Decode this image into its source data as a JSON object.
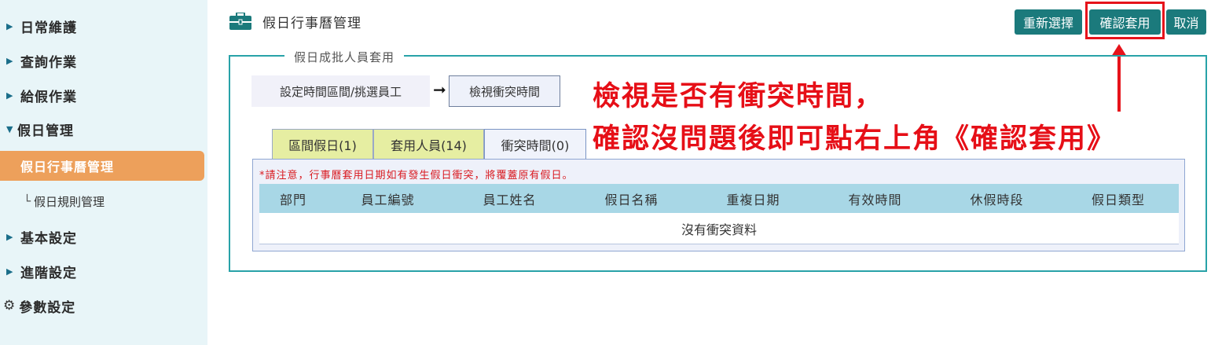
{
  "sidebar": {
    "items": [
      {
        "label": "日常維護"
      },
      {
        "label": "查詢作業"
      },
      {
        "label": "給假作業"
      },
      {
        "label": "假日管理"
      },
      {
        "label": "假日行事曆管理"
      },
      {
        "label": "假日規則管理",
        "prefix": "└"
      },
      {
        "label": "基本設定"
      },
      {
        "label": "進階設定"
      },
      {
        "label": "參數設定"
      }
    ]
  },
  "header": {
    "title": "假日行事曆管理",
    "buttons": {
      "reselect": "重新選擇",
      "confirm_apply": "確認套用",
      "cancel": "取消"
    }
  },
  "fieldset": {
    "legend": "假日成批人員套用",
    "steps": [
      "設定時間區間/挑選員工",
      "檢視衝突時間"
    ]
  },
  "annotation": {
    "line1": "檢視是否有衝突時間，",
    "line2": "確認沒問題後即可點右上角《確認套用》"
  },
  "tabs": [
    {
      "label": "區間假日(1)"
    },
    {
      "label": "套用人員(14)"
    },
    {
      "label": "衝突時間(0)"
    }
  ],
  "notice": "*請注意，行事曆套用日期如有發生假日衝突，將覆蓋原有假日。",
  "table": {
    "columns": [
      "部門",
      "員工編號",
      "員工姓名",
      "假日名稱",
      "重複日期",
      "有效時間",
      "休假時段",
      "假日類型"
    ],
    "empty_message": "沒有衝突資料"
  },
  "colors": {
    "accent": "#1b7a7c",
    "highlight": "#e6131b",
    "active_nav": "#eda05b",
    "sidebar_bg": "#e8f5f8",
    "table_header": "#a8d7e6"
  }
}
